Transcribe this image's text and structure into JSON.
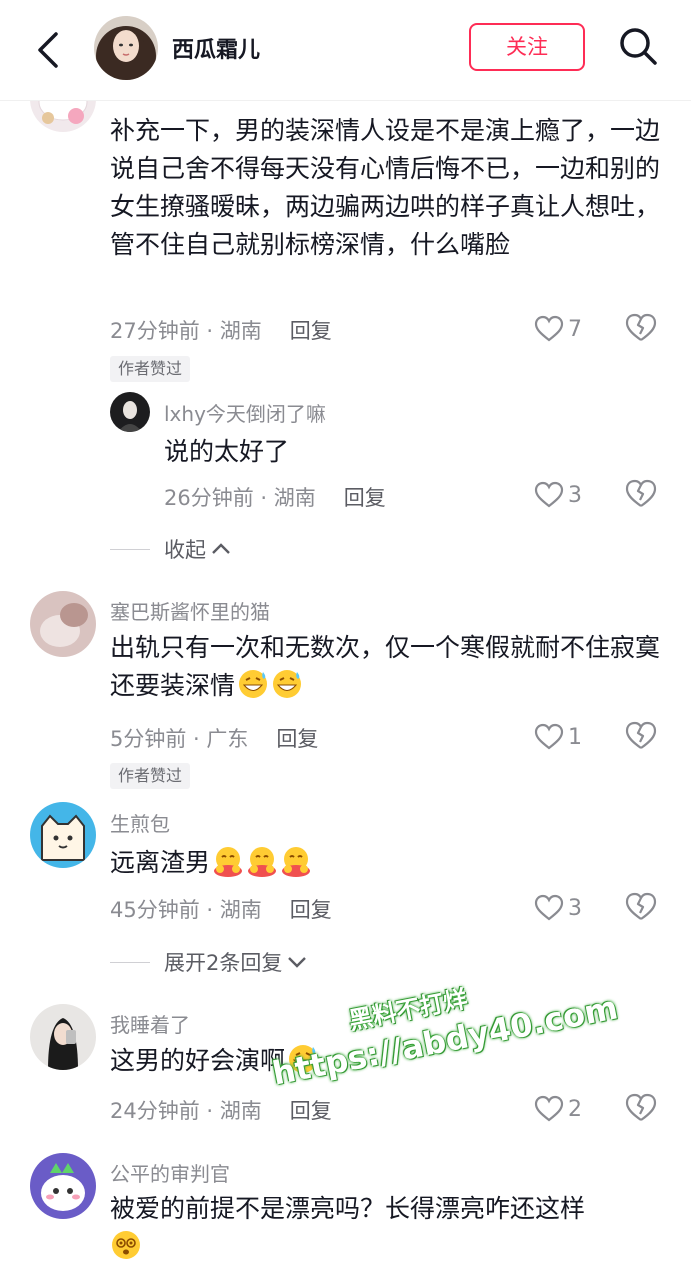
{
  "header": {
    "user_name": "西瓜霜儿",
    "follow_label": "关注",
    "back_icon": "chevron-left-icon",
    "search_icon": "search-icon"
  },
  "colors": {
    "accent": "#fe2c55",
    "text": "#161823",
    "secondary": "#8a8b91"
  },
  "comments": [
    {
      "text": "补充一下，男的装深情人设是不是演上瘾了，一边说自己舍不得每天没有心情后悔不已，一边和别的女生撩骚暧昧，两边骗两边哄的样子真让人想吐，管不住自己就别标榜深情，什么嘴脸",
      "time": "27分钟前",
      "location": "湖南",
      "reply_label": "回复",
      "likes": "7",
      "author_badge": "作者赞过",
      "replies": [
        {
          "name": "lxhy今天倒闭了嘛",
          "text": "说的太好了",
          "time": "26分钟前",
          "location": "湖南",
          "reply_label": "回复",
          "likes": "3"
        }
      ],
      "collapse_label": "收起"
    },
    {
      "name": "塞巴斯酱怀里的猫",
      "text": "出轨只有一次和无数次，仅一个寒假就耐不住寂寞还要装深情",
      "time": "5分钟前",
      "location": "广东",
      "reply_label": "回复",
      "likes": "1",
      "author_badge": "作者赞过"
    },
    {
      "name": "生煎包",
      "text": "远离渣男",
      "time": "45分钟前",
      "location": "湖南",
      "reply_label": "回复",
      "likes": "3",
      "expand_label": "展开2条回复"
    },
    {
      "name": "我睡着了",
      "text": "这男的好会演啊",
      "time": "24分钟前",
      "location": "湖南",
      "reply_label": "回复",
      "likes": "2"
    },
    {
      "name": "公平的审判官",
      "text": "被爱的前提不是漂亮吗？长得漂亮咋还这样"
    }
  ],
  "watermark": {
    "line1": "黑料不打烊",
    "line2": "https://abdy40.com"
  }
}
